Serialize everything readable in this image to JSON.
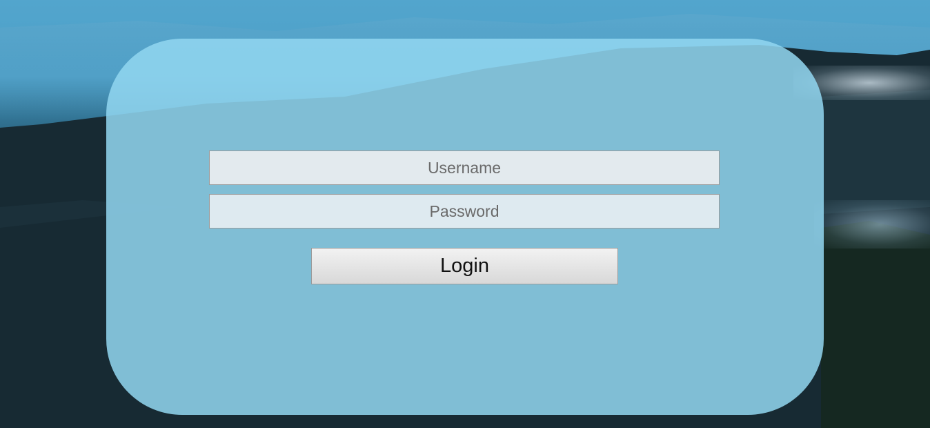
{
  "login_form": {
    "username_placeholder": "Username",
    "password_placeholder": "Password",
    "login_button_label": "Login"
  },
  "colors": {
    "card_background": "#92d6f0",
    "button_background": "#e4e4e4",
    "field_border": "#9a9a9a"
  }
}
